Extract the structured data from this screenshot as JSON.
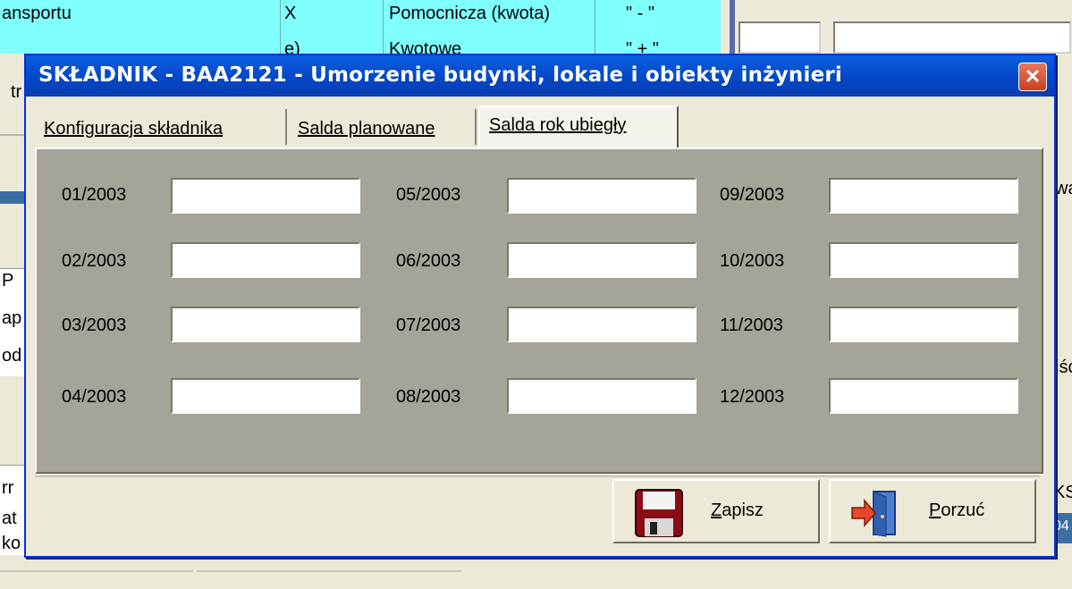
{
  "background": {
    "grid_cells": [
      "ansportu",
      "X",
      "Pomocnicza (kwota)",
      "\" - \""
    ],
    "grid_peek": [
      "e)",
      "Kwotowe",
      "\" + \""
    ],
    "left_fragments": [
      "tr",
      "P",
      "ap",
      "od",
      "rr",
      "at",
      "ko"
    ],
    "right_fragments": [
      "wa",
      "jśc",
      "KS.",
      "04"
    ]
  },
  "dialog": {
    "title": "SKŁADNIK - BAA2121 - Umorzenie budynki, lokale i obiekty inżynieri",
    "close_label": "✕",
    "tabs": [
      {
        "label": "Konfiguracja składnika"
      },
      {
        "label": "Salda planowane"
      },
      {
        "label": "Salda rok ubiegły"
      }
    ],
    "months": [
      {
        "label": "01/2003",
        "value": ""
      },
      {
        "label": "02/2003",
        "value": ""
      },
      {
        "label": "03/2003",
        "value": ""
      },
      {
        "label": "04/2003",
        "value": ""
      },
      {
        "label": "05/2003",
        "value": ""
      },
      {
        "label": "06/2003",
        "value": ""
      },
      {
        "label": "07/2003",
        "value": ""
      },
      {
        "label": "08/2003",
        "value": ""
      },
      {
        "label": "09/2003",
        "value": ""
      },
      {
        "label": "10/2003",
        "value": ""
      },
      {
        "label": "11/2003",
        "value": ""
      },
      {
        "label": "12/2003",
        "value": ""
      }
    ],
    "buttons": {
      "save_accel": "Z",
      "save_rest": "apisz",
      "cancel_accel": "P",
      "cancel_rest": "orzuć"
    }
  },
  "colors": {
    "titlebar": "#0447c8",
    "panel": "#a6a399",
    "grid_bg": "#80ffff"
  }
}
